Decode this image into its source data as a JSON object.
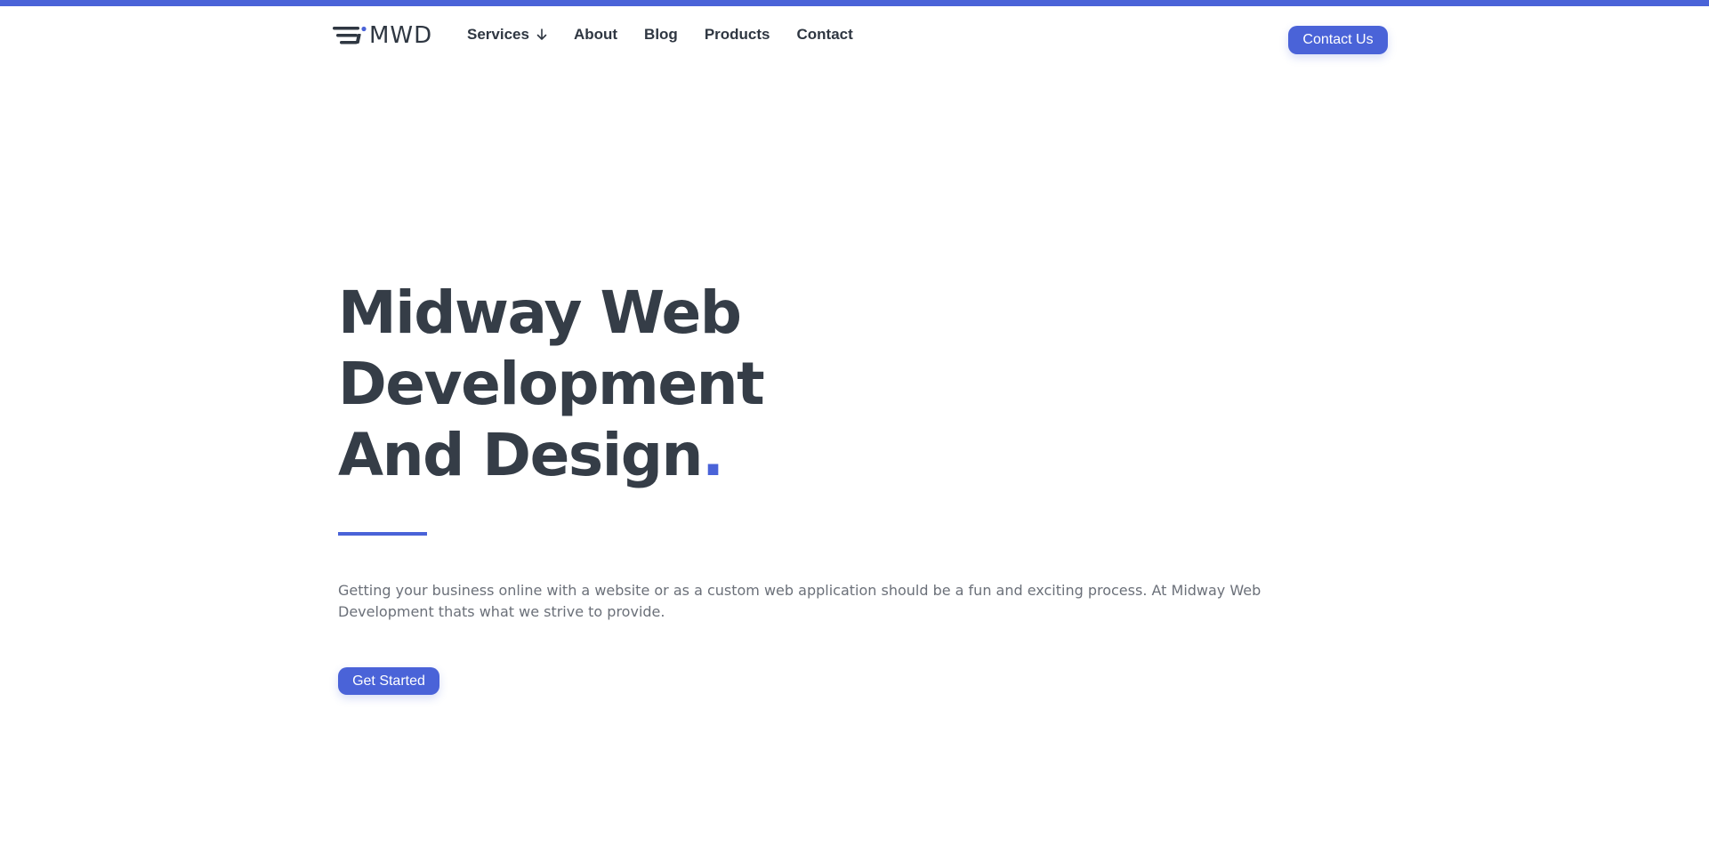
{
  "theme": {
    "accent": "#4a63d8",
    "heading_color": "#353d47",
    "text_color": "#6b7079",
    "background": "#ffffff"
  },
  "logo": {
    "text": "MWD",
    "icon": "mwd-logo-mark-icon"
  },
  "nav": {
    "items": [
      {
        "label": "Services",
        "icon": "arrow-down-icon"
      },
      {
        "label": "About"
      },
      {
        "label": "Blog"
      },
      {
        "label": "Products"
      },
      {
        "label": "Contact"
      }
    ],
    "cta_label": "Contact Us"
  },
  "hero": {
    "title": "Midway Web Development And Design",
    "title_dot": ".",
    "description": "Getting your business online with a website or as a custom web application should be a fun and exciting process. At Midway Web Development thats what we strive to provide.",
    "cta_label": "Get Started"
  }
}
